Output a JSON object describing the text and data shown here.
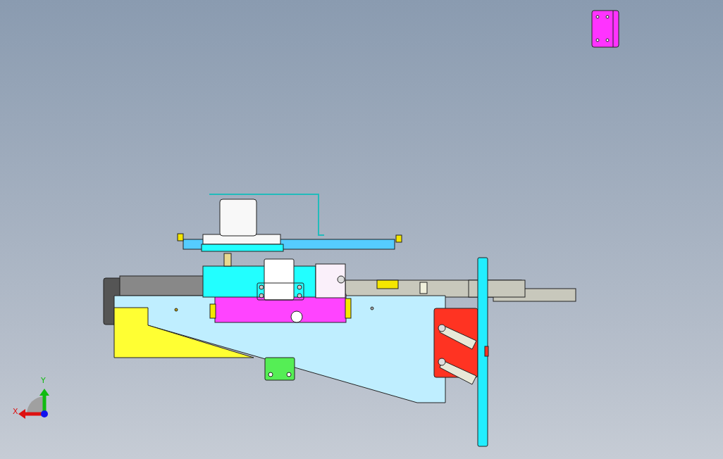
{
  "axis_triad": {
    "x_label": "X",
    "y_label": "Y"
  }
}
